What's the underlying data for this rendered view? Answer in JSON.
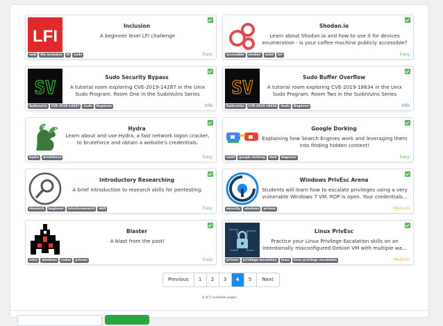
{
  "rooms": [
    {
      "title": "Inclusion",
      "desc": "A beginner level LFI challenge",
      "tags": [
        "web",
        "file inclusion",
        "lfi",
        "sudo"
      ],
      "difficulty": "Easy",
      "icon": "lfi-logo-icon"
    },
    {
      "title": "Shodan.io",
      "desc": "Learn about Shodan.io and how to use it for devices enumeration - is your coffee machine publicly accessible?",
      "tags": [
        "accessible",
        "shodan",
        "osint",
        "iot"
      ],
      "difficulty": "Easy",
      "icon": "shodan-logo-icon"
    },
    {
      "title": "Sudo Security Bypass",
      "desc": "A tutorial room exploring CVE-2019-14287 in the Unix Sudo Program. Room One in the SudoVulns Series",
      "tags": [
        "Sudovulns",
        "CVE-2019-14287",
        "Sudo",
        "Beginner"
      ],
      "difficulty": "Info",
      "icon": "sudovulns-logo-icon"
    },
    {
      "title": "Sudo Buffer Overflow",
      "desc": "A tutorial room exploring CVE-2019-18634 in the Unix Sudo Program. Room Two in the SudoVulns Series",
      "tags": [
        "Sudovulns",
        "CVE-2019-18634",
        "Sudo",
        "Beginner"
      ],
      "difficulty": "Info",
      "icon": "sudovulns-orange-logo-icon"
    },
    {
      "title": "Hydra",
      "desc": "Learn about and use Hydra, a fast network logon cracker, to bruteforce and obtain a website's credentials.",
      "tags": [
        "hydra",
        "bruteforce"
      ],
      "difficulty": "Easy",
      "icon": "hydra-dragon-icon"
    },
    {
      "title": "Google Dorking",
      "desc": "Explaining how Search Engines work and leveraging them into finding hidden content!",
      "tags": [
        "osint",
        "google dorking",
        "dork",
        "beginner"
      ],
      "difficulty": "Easy",
      "icon": "google-glasses-icon"
    },
    {
      "title": "Introductory Researching",
      "desc": "A brief introduction to research skills for pentesting.",
      "tags": [
        "research",
        "beginner",
        "introtoresearch",
        "skill"
      ],
      "difficulty": "Easy",
      "icon": "magnifier-icon"
    },
    {
      "title": "Windows PrivEsc Arena",
      "desc": "Students will learn how to escalate privileges using a very vulnerable Windows 7 VM. RDP is open. Your credentials...",
      "tags": [
        "security",
        "windows",
        "privesc"
      ],
      "difficulty": "Medium",
      "icon": "windows-privesc-logo-icon"
    },
    {
      "title": "Blaster",
      "desc": "A blast from the past!",
      "tags": [
        "retro",
        "windows",
        "redux",
        "privesc"
      ],
      "difficulty": "Easy",
      "icon": "blaster-ship-icon"
    },
    {
      "title": "Linux PrivEsc",
      "desc": "Practice your Linux Privilege Escalation skills on an intentionally misconfigured Debian VM with multiple wa...",
      "tags": [
        "privesc",
        "privilege escalation",
        "linux",
        "linux privilege escalation"
      ],
      "difficulty": "Medium",
      "icon": "padlock-circuit-icon"
    }
  ],
  "pagination": {
    "previous": "Previous",
    "pages": [
      "1",
      "2",
      "3",
      "4",
      "5"
    ],
    "active": "4",
    "next": "Next",
    "info": "4 of 5 available pages"
  },
  "colors": {
    "easy": "#5cb85c",
    "medium": "#f0ad4e",
    "info": "#337ab7",
    "active_page": "#1c8aec",
    "tag_bg": "#666c73"
  }
}
